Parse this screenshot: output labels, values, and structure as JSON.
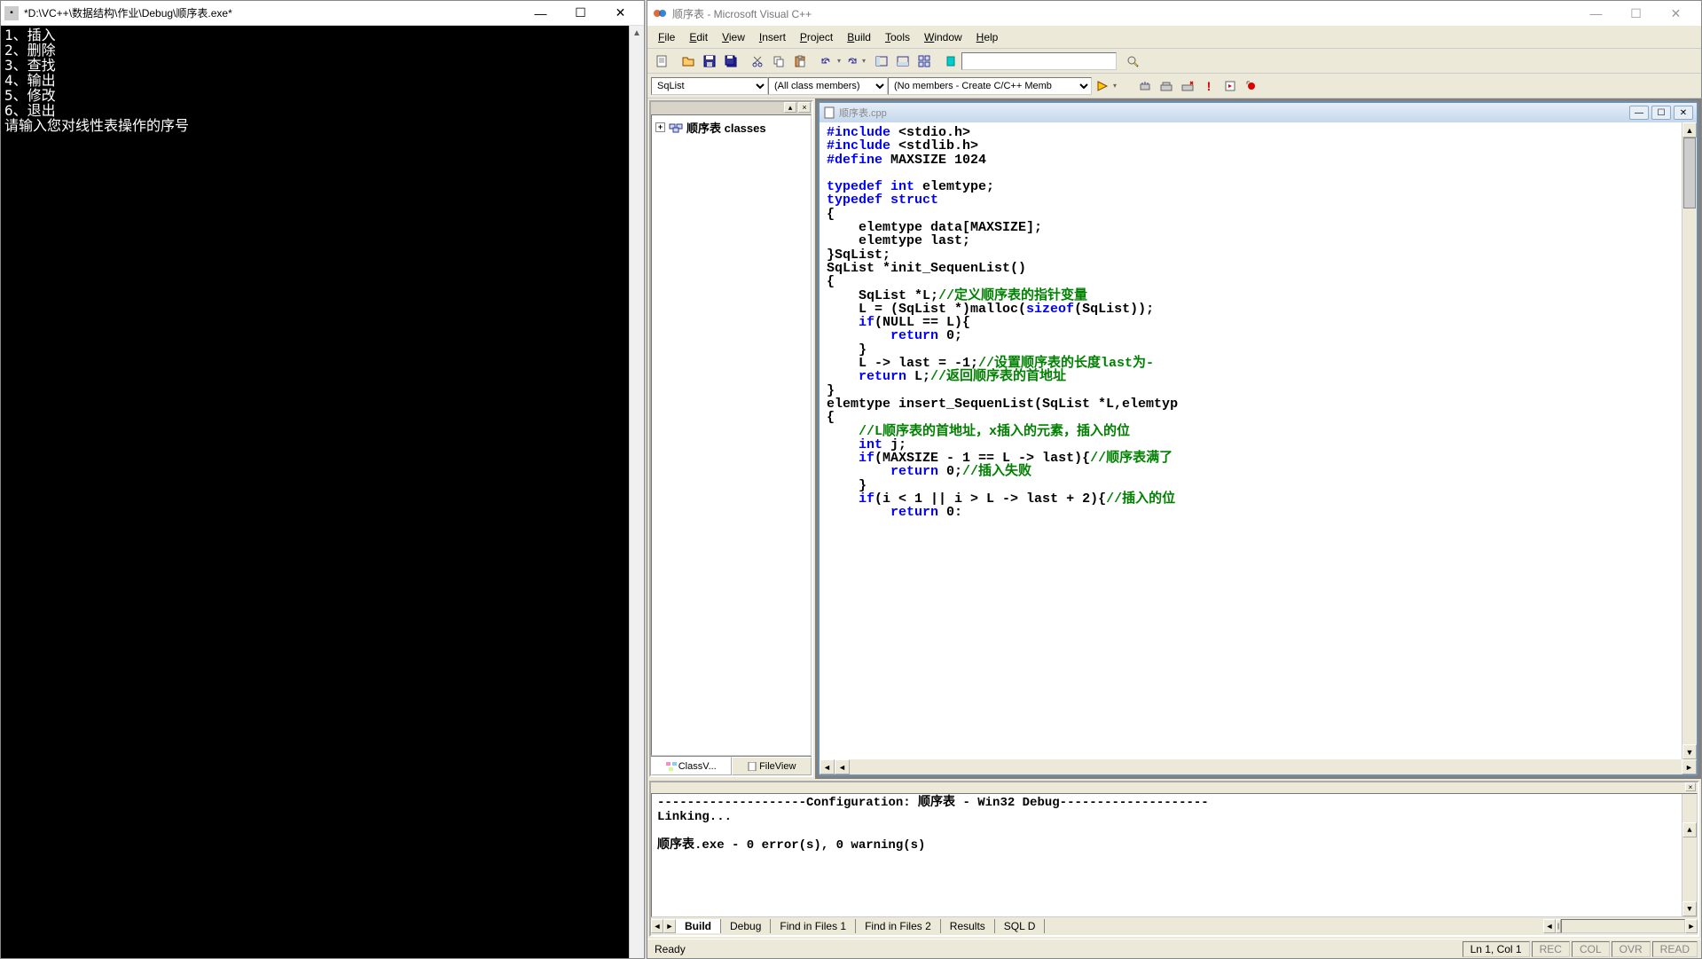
{
  "console": {
    "title": "*D:\\VC++\\数据结构\\作业\\Debug\\顺序表.exe*",
    "lines": [
      "1、插入",
      "2、删除",
      "3、查找",
      "4、输出",
      "5、修改",
      "6、退出",
      "请输入您对线性表操作的序号"
    ]
  },
  "ide": {
    "title": "顺序表 - Microsoft Visual C++",
    "menu": [
      "File",
      "Edit",
      "View",
      "Insert",
      "Project",
      "Build",
      "Tools",
      "Window",
      "Help"
    ],
    "combo1": "SqList",
    "combo2": "(All class members)",
    "combo3": "(No members - Create C/C++ Memb",
    "tree": {
      "root": "顺序表 classes",
      "tab_class": "ClassV...",
      "tab_file": "FileView"
    },
    "editor": {
      "filename": "顺序表.cpp"
    },
    "output": {
      "line1": "--------------------Configuration: 顺序表 - Win32 Debug--------------------",
      "line2": "Linking...",
      "line3": "",
      "line4": "顺序表.exe - 0 error(s), 0 warning(s)",
      "tabs": [
        "Build",
        "Debug",
        "Find in Files 1",
        "Find in Files 2",
        "Results",
        "SQL D"
      ]
    },
    "status": {
      "ready": "Ready",
      "pos": "Ln 1, Col 1",
      "rec": "REC",
      "col": "COL",
      "ovr": "OVR",
      "read": "READ"
    }
  }
}
